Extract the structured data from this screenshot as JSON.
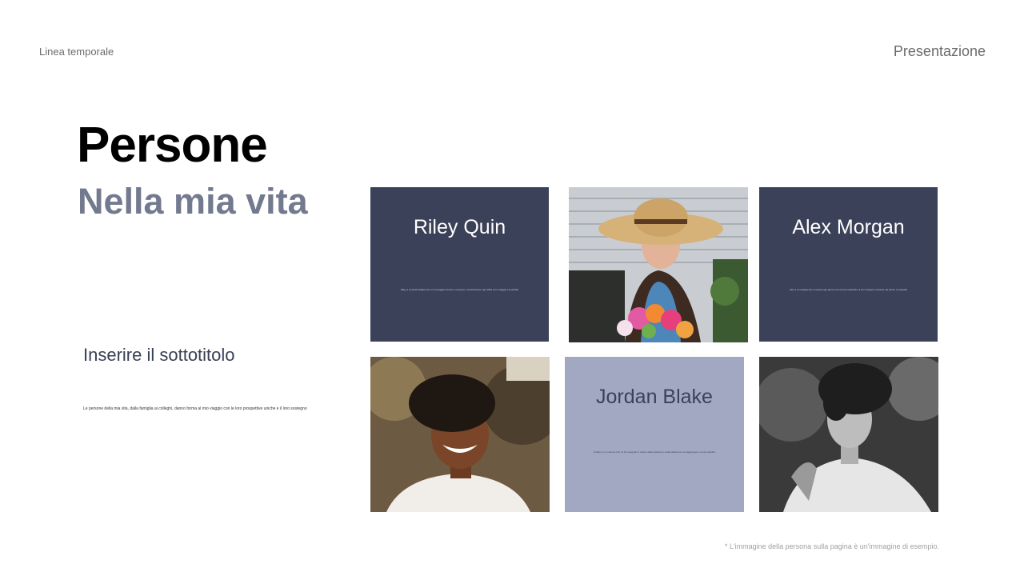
{
  "nav": {
    "left_label": "Linea temporale",
    "right_label": "Presentazione"
  },
  "header": {
    "title": "Persone",
    "subtitle": "Nella mia vita"
  },
  "section": {
    "subtitle": "Inserire il sottotitolo",
    "description": "Le persone della mia vita, dalla famiglia ai colleghi, danno forma al mio viaggio con le loro prospettive uniche e il loro sostegno"
  },
  "cards": [
    {
      "name": "Riley Quin",
      "desc": "Riley è un'amica fidata che mi incoraggia sempre a crescere e ad affrontare ogni sfida con coraggio e positività"
    },
    {
      "name": "Alex Morgan",
      "desc": "Alex è un collega che mi ispira ogni giorno con la sua creatività e il suo impegno costante nel lavoro di squadra"
    },
    {
      "name": "Jordan Blake",
      "desc": "Jordan è un mentore che mi ha insegnato il valore della pazienza e della dedizione nel raggiungere i propri obiettivi"
    }
  ],
  "footnote": "* L'immagine della persona sulla pagina è un'immagine di esempio."
}
